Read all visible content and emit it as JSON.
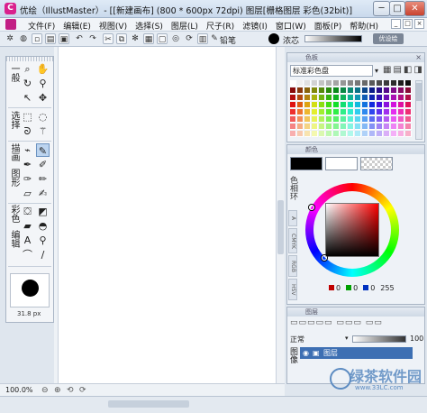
{
  "window": {
    "title": "优绘（IllustMaster）- [[新建画布] (800 * 600px 72dpi)    图层[栅格图层 彩色(32bit)]",
    "app_icon": "C",
    "min": "─",
    "max": "□",
    "close": "✕"
  },
  "menu": {
    "items": [
      "文件(F)",
      "编辑(E)",
      "视图(V)",
      "选择(S)",
      "图层(L)",
      "尺子(R)",
      "滤镜(I)",
      "窗口(W)",
      "面板(P)",
      "帮助(H)"
    ],
    "right": [
      "_",
      "□",
      "×"
    ]
  },
  "toolbar": {
    "brush_name": "铅笔",
    "density_label": "浓芯",
    "brand": "优设绘"
  },
  "tool_panel": {
    "groups": [
      "一般",
      "选择",
      "描画",
      "图形",
      "彩色",
      "编辑"
    ],
    "brush_size": "31.8 px"
  },
  "status": {
    "zoom": "100.0%"
  },
  "swatch_panel": {
    "title": "色板",
    "set": "标准彩色盘",
    "close": "×"
  },
  "color_panel": {
    "title": "颜色",
    "side_label": "色相环",
    "tabs": [
      "A",
      "CMYK",
      "RGB",
      "HSV"
    ],
    "values": {
      "r": "0",
      "g": "0",
      "b": "0",
      "alpha": "255"
    },
    "colors": {
      "fg": "#000000",
      "bg": "#ffffff",
      "accent": "#ff0000"
    }
  },
  "layer_panel": {
    "title": "图层",
    "blend_mode": "正常",
    "opacity": "100",
    "side_label": "图像",
    "layer_name": "图层"
  },
  "watermark": {
    "text": "绿茶软件园",
    "url": "www.33LC.com"
  }
}
